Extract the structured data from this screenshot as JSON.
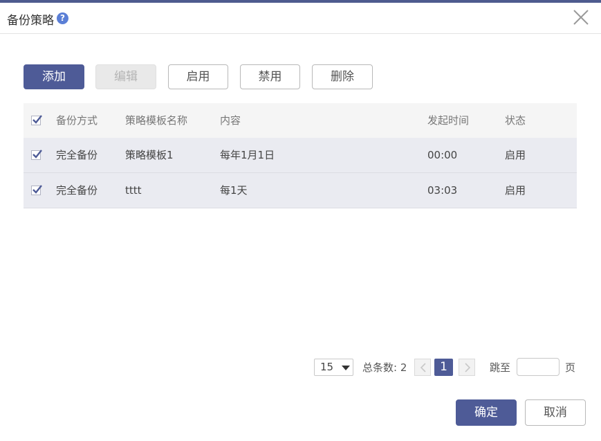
{
  "dialog": {
    "title": "备份策略",
    "help_symbol": "?"
  },
  "toolbar": {
    "add": "添加",
    "edit": "编辑",
    "enable": "启用",
    "disable": "禁用",
    "delete": "删除"
  },
  "table": {
    "columns": [
      "备份方式",
      "策略模板名称",
      "内容",
      "发起时间",
      "状态"
    ],
    "rows": [
      {
        "checked": true,
        "method": "完全备份",
        "template": "策略模板1",
        "content": "每年1月1日",
        "time": "00:00",
        "status": "启用"
      },
      {
        "checked": true,
        "method": "完全备份",
        "template": "tttt",
        "content": "每1天",
        "time": "03:03",
        "status": "启用"
      }
    ]
  },
  "pagination": {
    "page_size": "15",
    "total_label": "总条数: 2",
    "current_page": "1",
    "jump_label": "跳至",
    "page_unit": "页",
    "jump_value": ""
  },
  "footer": {
    "confirm": "确定",
    "cancel": "取消"
  },
  "colors": {
    "accent": "#4e5b97",
    "row_bg": "#eaebf1",
    "header_bg": "#f5f5f5"
  }
}
